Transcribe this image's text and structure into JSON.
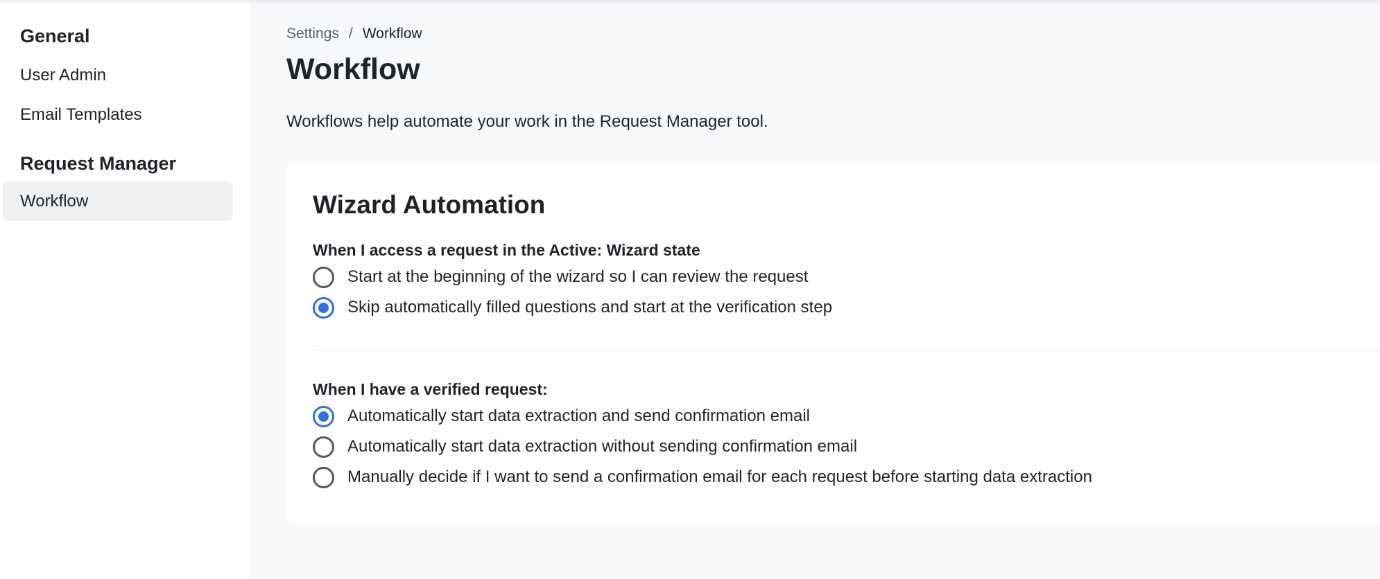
{
  "sidebar": {
    "groups": [
      {
        "title": "General",
        "items": [
          {
            "label": "User Admin"
          },
          {
            "label": "Email Templates"
          }
        ]
      },
      {
        "title": "Request Manager",
        "items": [
          {
            "label": "Workflow",
            "active": true
          }
        ]
      }
    ]
  },
  "breadcrumb": {
    "root": "Settings",
    "separator": "/",
    "current": "Workflow"
  },
  "page": {
    "title": "Workflow",
    "description": "Workflows help automate your work in the Request Manager tool."
  },
  "card": {
    "title": "Wizard Automation",
    "sections": [
      {
        "label": "When I access a request in the Active: Wizard state",
        "options": [
          {
            "label": "Start at the beginning of the wizard so I can review the request",
            "checked": false
          },
          {
            "label": "Skip automatically filled questions and start at the verification step",
            "checked": true
          }
        ]
      },
      {
        "label": "When I have a verified request:",
        "options": [
          {
            "label": "Automatically start data extraction and send confirmation email",
            "checked": true
          },
          {
            "label": "Automatically start data extraction without sending confirmation email",
            "checked": false
          },
          {
            "label": "Manually decide if I want to send a confirmation email for each request before starting data extraction",
            "checked": false
          }
        ]
      }
    ]
  },
  "colors": {
    "accent": "#2f6fe0",
    "sidebar_active_bg": "#eff0f2",
    "page_bg": "#f7f8fa"
  }
}
